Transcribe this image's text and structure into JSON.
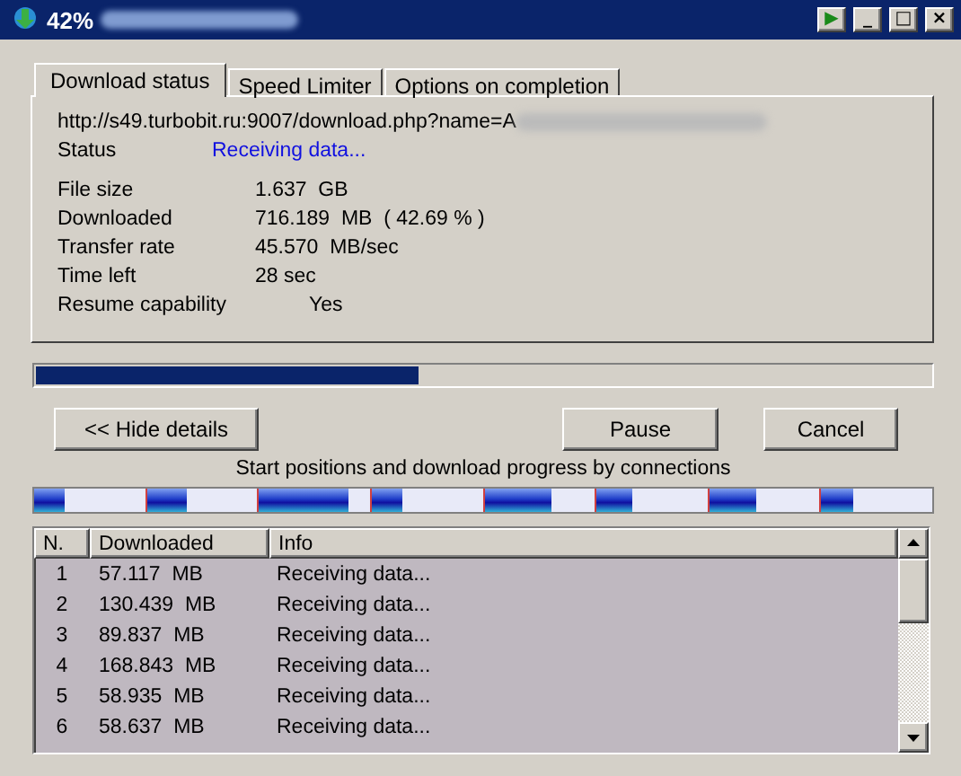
{
  "window": {
    "title": "42%",
    "controls": [
      "▶",
      "_",
      "□",
      "×"
    ]
  },
  "tabs": [
    {
      "label": "Download status",
      "selected": true
    },
    {
      "label": "Speed Limiter",
      "selected": false
    },
    {
      "label": "Options on completion",
      "selected": false
    }
  ],
  "status": {
    "url": "http://s49.turbobit.ru:9007/download.php?name=A",
    "status_label": "Status",
    "status_value": "Receiving data...",
    "fields": [
      {
        "label": "File size",
        "value": "1.637  GB"
      },
      {
        "label": "Downloaded",
        "value": "716.189  MB  ( 42.69 % )"
      },
      {
        "label": "Transfer rate",
        "value": "45.570  MB/sec"
      },
      {
        "label": "Time left",
        "value": "28 sec"
      },
      {
        "label": "Resume capability",
        "value": "Yes"
      }
    ]
  },
  "progress": {
    "level": 0.427
  },
  "buttons": {
    "hide_details": "<< Hide details",
    "pause": "Pause",
    "cancel": "Cancel"
  },
  "connections": {
    "caption": "Start positions and download progress by connections",
    "segments": [
      {
        "level": 0.27
      },
      {
        "level": 0.37
      },
      {
        "level": 0.8
      },
      {
        "level": 0.28
      },
      {
        "level": 0.61
      },
      {
        "level": 0.33
      },
      {
        "level": 0.42
      },
      {
        "level": 0.28
      }
    ]
  },
  "table": {
    "columns": [
      "N.",
      "Downloaded",
      "Info"
    ],
    "rows": [
      [
        "1",
        "57.117  MB",
        "Receiving data..."
      ],
      [
        "2",
        "130.439  MB",
        "Receiving data..."
      ],
      [
        "3",
        "89.837  MB",
        "Receiving data..."
      ],
      [
        "4",
        "168.843  MB",
        "Receiving data..."
      ],
      [
        "5",
        "58.935  MB",
        "Receiving data..."
      ],
      [
        "6",
        "58.637  MB",
        "Receiving data..."
      ]
    ]
  }
}
